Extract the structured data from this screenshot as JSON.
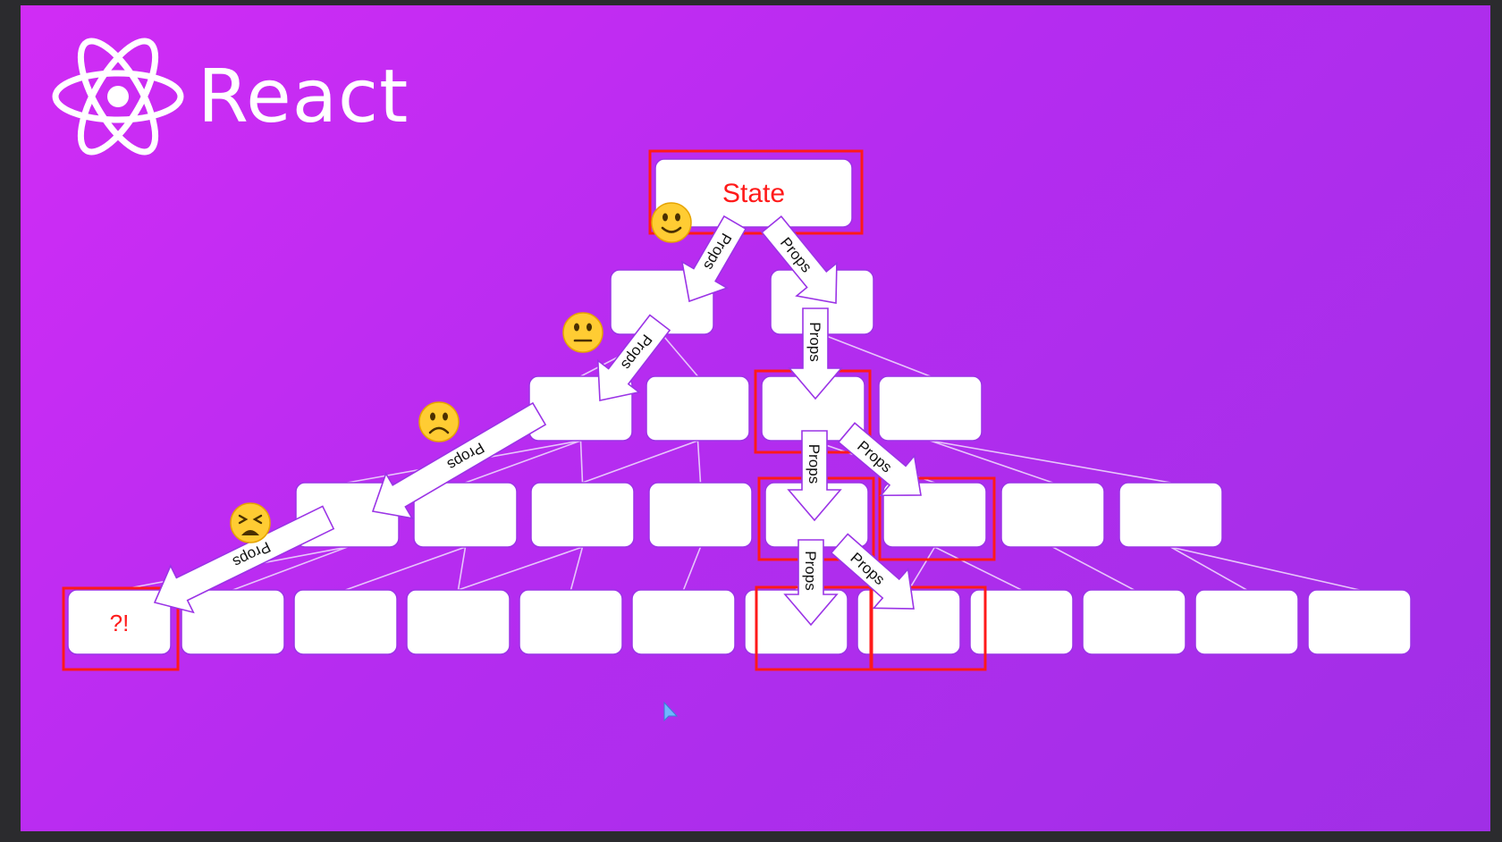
{
  "brand": {
    "name": "React",
    "logo_icon": "react-atom-icon",
    "logo_color": "#ffffff"
  },
  "colors": {
    "background_start": "#d12cf5",
    "background_end": "#a02fe6",
    "node_fill": "#ffffff",
    "node_stroke": "#9b34e6",
    "highlight": "#ff1a1a",
    "text_red": "#ff1a1a",
    "connector": "#e7c6fb"
  },
  "diagram": {
    "root_label": "State",
    "leaf_label": "?!",
    "edge_label": "Props",
    "emoji_faces": [
      "slightly-smiling-face",
      "neutral-face",
      "frowning-face",
      "weary-face"
    ]
  }
}
